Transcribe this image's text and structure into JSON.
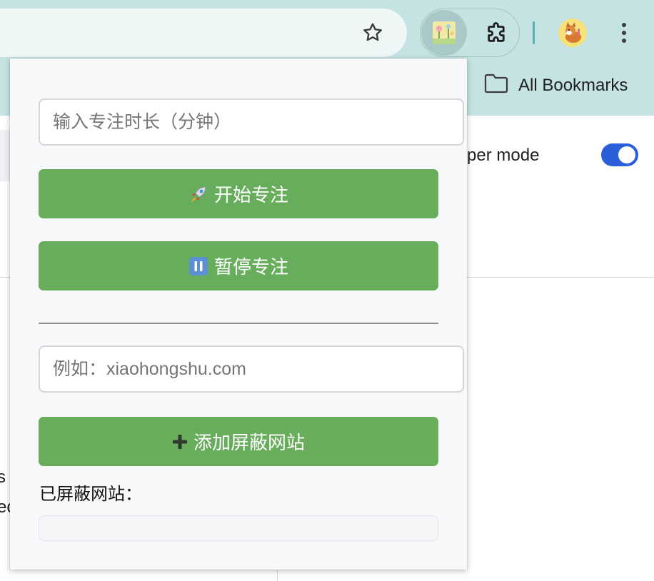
{
  "browser": {
    "bookmarks_label": "All Bookmarks",
    "accent_color": "#c6e3e3"
  },
  "background_page": {
    "developer_mode_label": "veloper mode",
    "developer_mode_on": true,
    "edge_text_1": "s",
    "edge_text_2": "ec"
  },
  "popup": {
    "duration_input": {
      "placeholder": "输入专注时长（分钟）",
      "value": ""
    },
    "start_button": {
      "label": "开始专注",
      "icon": "rocket-icon"
    },
    "pause_button": {
      "label": "暂停专注",
      "icon": "pause-icon"
    },
    "site_input": {
      "placeholder": "例如：xiaohongshu.com",
      "value": ""
    },
    "add_button": {
      "label": "添加屏蔽网站",
      "icon": "plus-icon"
    },
    "blocked_label": "已屏蔽网站：",
    "blocked_sites": [],
    "button_color": "#67ad5b"
  }
}
